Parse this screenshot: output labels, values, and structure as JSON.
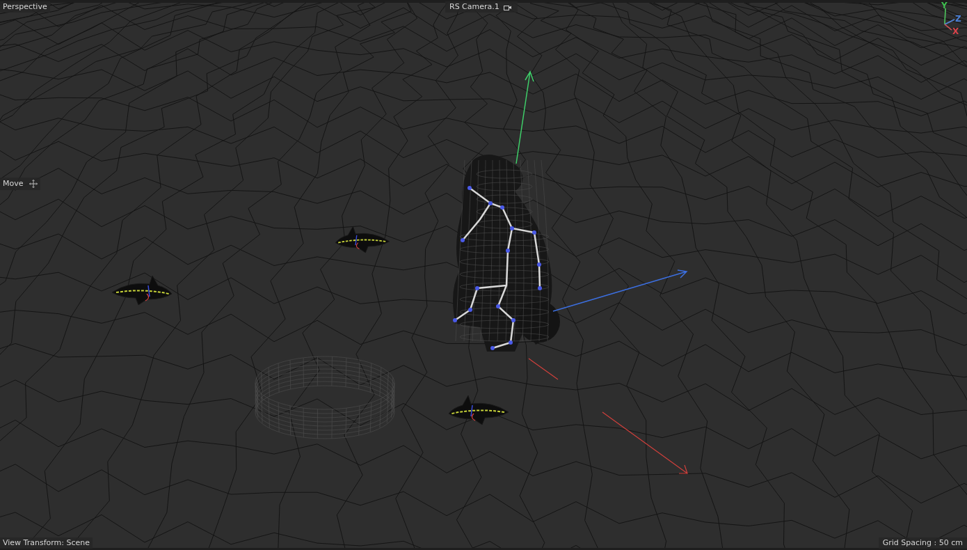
{
  "viewport": {
    "view_name": "Perspective",
    "camera": "RS Camera.1",
    "tool": "Move",
    "view_transform": "View Transform: Scene",
    "grid_spacing": "Grid Spacing : 50 cm"
  },
  "axis_gizmo": [
    {
      "text": "Y",
      "color": "#3fbf4f"
    },
    {
      "text": "Z",
      "color": "#4a7fd6"
    },
    {
      "text": "X",
      "color": "#d9434a"
    }
  ]
}
